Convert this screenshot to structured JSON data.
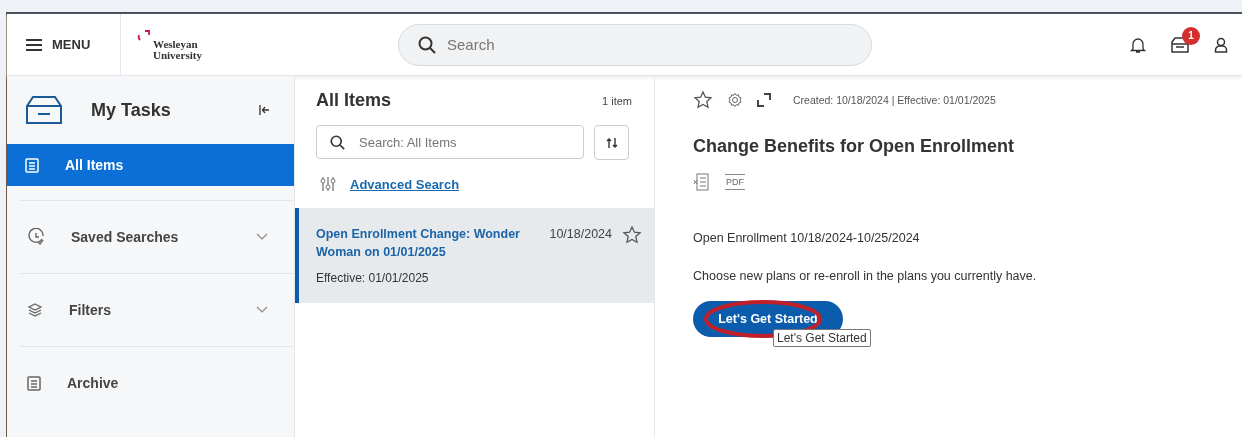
{
  "header": {
    "menu_label": "MENU",
    "logo_lines": [
      "Wesleyan",
      "University"
    ],
    "search": {
      "placeholder": "Search"
    },
    "inbox_badge": "1"
  },
  "sidebar": {
    "title": "My Tasks",
    "items": [
      {
        "label": "All Items",
        "selected": true,
        "expandable": false
      },
      {
        "label": "Saved Searches",
        "selected": false,
        "expandable": true
      },
      {
        "label": "Filters",
        "selected": false,
        "expandable": true
      },
      {
        "label": "Archive",
        "selected": false,
        "expandable": false
      }
    ]
  },
  "list": {
    "title": "All Items",
    "count": "1 item",
    "search": {
      "placeholder": "Search: All Items"
    },
    "advanced_search": "Advanced Search",
    "items": [
      {
        "title": "Open Enrollment Change: Wonder Woman on 01/01/2025",
        "date": "10/18/2024",
        "subtitle": "Effective: 01/01/2025",
        "selected": true,
        "starred": false
      }
    ]
  },
  "detail": {
    "meta": "Created: 10/18/2024 | Effective: 01/01/2025",
    "title": "Change Benefits for Open Enrollment",
    "period": "Open Enrollment 10/18/2024-10/25/2024",
    "description": "Choose new plans or re-enroll in the plans you currently have.",
    "pdf_label": "PDF",
    "button": "Let's Get Started",
    "tooltip": "Let's Get Started",
    "highlighted": true
  }
}
